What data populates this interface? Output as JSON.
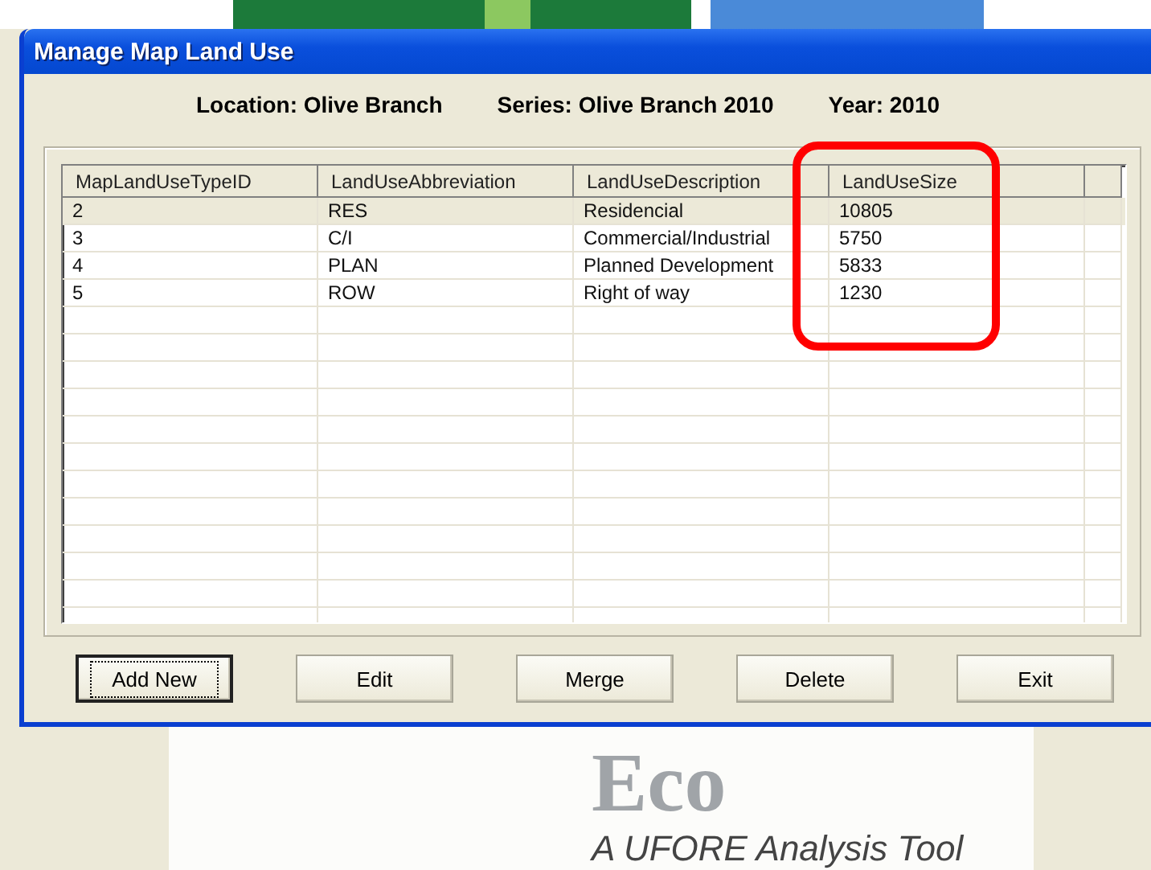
{
  "window": {
    "title": "Manage Map Land Use"
  },
  "info": [
    "Location: Olive Branch",
    "Series: Olive Branch 2010",
    "Year: 2010"
  ],
  "table": {
    "columns": [
      "MapLandUseTypeID",
      "LandUseAbbreviation",
      "LandUseDescription",
      "LandUseSize"
    ],
    "rows": [
      {
        "cells": [
          "2",
          "RES",
          "Residencial",
          "10805"
        ],
        "selected": true
      },
      {
        "cells": [
          "3",
          "C/I",
          "Commercial/Industrial",
          "5750"
        ],
        "selected": false
      },
      {
        "cells": [
          "4",
          "PLAN",
          "Planned Development",
          "5833"
        ],
        "selected": false
      },
      {
        "cells": [
          "5",
          "ROW",
          "Right of way",
          "1230"
        ],
        "selected": false
      }
    ]
  },
  "buttons": [
    {
      "label": "Add New",
      "focused": true
    },
    {
      "label": "Edit",
      "focused": false
    },
    {
      "label": "Merge",
      "focused": false
    },
    {
      "label": "Delete",
      "focused": false
    },
    {
      "label": "Exit",
      "focused": false
    }
  ],
  "background": {
    "logo": "Eco",
    "tagline": "A UFORE Analysis Tool"
  }
}
